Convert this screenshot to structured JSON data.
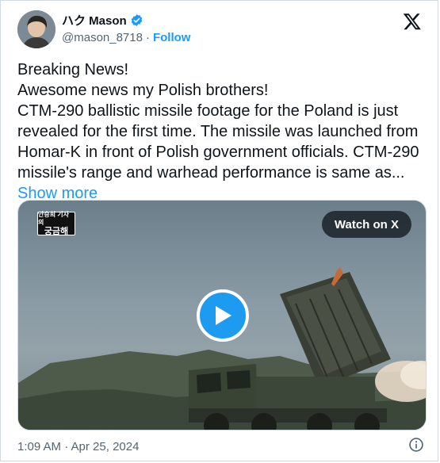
{
  "author": {
    "display_name": "ハク Mason",
    "handle": "@mason_8718",
    "separator": "·",
    "follow_label": "Follow"
  },
  "tweet": {
    "lines": [
      "Breaking News!",
      "Awesome news my Polish brothers!",
      "CTM-290 ballistic missile footage for the Poland is just revealed for the first time. The missile was launched from Homar-K in front of Polish government officials. CTM-290 missile's range and warhead performance is same as..."
    ],
    "show_more_label": "Show more"
  },
  "media": {
    "watermark_small": "안승희 기자의",
    "watermark_big": "궁금해",
    "watch_label": "Watch on X"
  },
  "footer": {
    "timestamp": "1:09 AM · Apr 25, 2024"
  },
  "colors": {
    "accent": "#1d9bf0",
    "text": "#0f1419",
    "secondary": "#536471"
  },
  "icons": {
    "verified": "verified-badge-icon",
    "logo": "x-logo-icon",
    "play": "play-icon",
    "info": "info-icon"
  }
}
